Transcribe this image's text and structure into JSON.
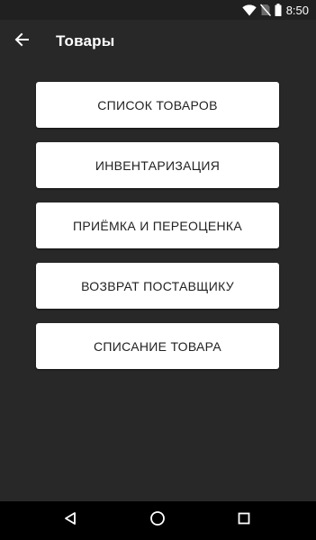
{
  "status_bar": {
    "time": "8:50",
    "icons": [
      "wifi-icon",
      "no-sim-icon",
      "battery-icon"
    ]
  },
  "app_bar": {
    "title": "Товары",
    "back_icon": "arrow-left-icon"
  },
  "menu": {
    "items": [
      {
        "label": "СПИСОК ТОВАРОВ"
      },
      {
        "label": "ИНВЕНТАРИЗАЦИЯ"
      },
      {
        "label": "ПРИЁМКА И ПЕРЕОЦЕНКА"
      },
      {
        "label": "ВОЗВРАТ ПОСТАВЩИКУ"
      },
      {
        "label": "СПИСАНИЕ ТОВАРА"
      }
    ]
  },
  "nav_bar": {
    "icons": [
      "back-triangle-icon",
      "home-circle-icon",
      "recents-square-icon"
    ]
  },
  "colors": {
    "background": "#282828",
    "button": "#ffffff",
    "button_text": "#222222",
    "nav_bar": "#000000"
  }
}
